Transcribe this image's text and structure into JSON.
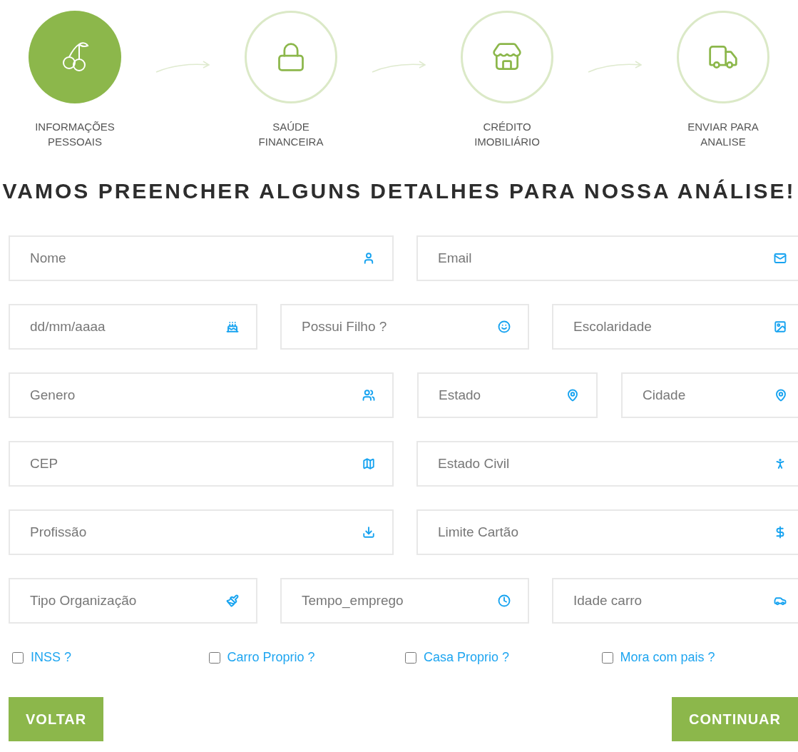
{
  "steps": [
    {
      "label": "INFORMAÇÕES PESSOAIS",
      "selected": true
    },
    {
      "label": "SAÚDE FINANCEIRA",
      "selected": false
    },
    {
      "label": "CRÉDITO IMOBILIÁRIO",
      "selected": false
    },
    {
      "label": "ENVIAR PARA ANALISE",
      "selected": false
    }
  ],
  "heading": "VAMOS PREENCHER ALGUNS DETALHES PARA NOSSA ANÁLISE!",
  "rows": [
    {
      "fields": [
        {
          "placeholder": "Nome"
        },
        {
          "placeholder": "Email"
        }
      ]
    },
    {
      "fields": [
        {
          "placeholder": "dd/mm/aaaa"
        },
        {
          "placeholder": "Possui Filho ?"
        },
        {
          "placeholder": "Escolaridade"
        }
      ]
    },
    {
      "fields": [
        {
          "placeholder": "Genero"
        },
        {
          "placeholder": "Estado"
        },
        {
          "placeholder": "Cidade"
        }
      ]
    },
    {
      "fields": [
        {
          "placeholder": "CEP"
        },
        {
          "placeholder": "Estado Civil"
        }
      ]
    },
    {
      "fields": [
        {
          "placeholder": "Profissão"
        },
        {
          "placeholder": "Limite Cartão"
        }
      ]
    },
    {
      "fields": [
        {
          "placeholder": "Tipo Organização"
        },
        {
          "placeholder": "Tempo_emprego"
        },
        {
          "placeholder": "Idade carro"
        }
      ]
    }
  ],
  "checkboxes": [
    {
      "label": "INSS ?",
      "checked": false
    },
    {
      "label": "Carro Proprio ?",
      "checked": false
    },
    {
      "label": "Casa Proprio ?",
      "checked": false
    },
    {
      "label": "Mora com pais ?",
      "checked": false
    }
  ],
  "buttons": [
    {
      "label": "VOLTAR"
    },
    {
      "label": "CONTINUAR"
    }
  ]
}
